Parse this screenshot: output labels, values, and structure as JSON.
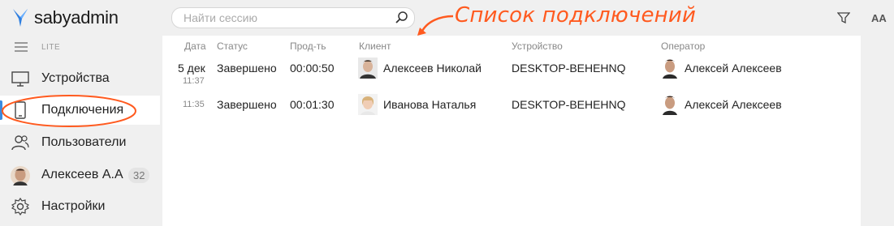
{
  "app": {
    "logo_text": "sabyadmin",
    "edition": "LITE"
  },
  "sidebar": {
    "items": [
      {
        "label": "Устройства",
        "icon": "monitor-icon"
      },
      {
        "label": "Подключения",
        "icon": "phone-icon"
      },
      {
        "label": "Пользователи",
        "icon": "users-icon"
      },
      {
        "label": "Алексеев А.А",
        "icon": "avatar",
        "count": "32"
      },
      {
        "label": "Настройки",
        "icon": "gear-icon"
      }
    ]
  },
  "search": {
    "placeholder": "Найти сессию",
    "value": ""
  },
  "toolbar": {
    "filter_icon": "filter-icon",
    "font_size_label": "AA"
  },
  "annotation": {
    "text": "Список подключений",
    "color": "#ff5a1f"
  },
  "table": {
    "headers": [
      "Дата",
      "Статус",
      "Прод-ть",
      "Клиент",
      "Устройство",
      "Оператор"
    ],
    "rows": [
      {
        "date": "5 дек",
        "time": "11:37",
        "status": "Завершено",
        "duration": "00:00:50",
        "client": "Алексеев Николай",
        "device": "DESKTOP-BEHEHNQ",
        "operator": "Алексей Алексеев"
      },
      {
        "date": "",
        "time": "11:35",
        "status": "Завершено",
        "duration": "00:01:30",
        "client": "Иванова Наталья",
        "device": "DESKTOP-BEHEHNQ",
        "operator": "Алексей Алексеев"
      }
    ]
  }
}
